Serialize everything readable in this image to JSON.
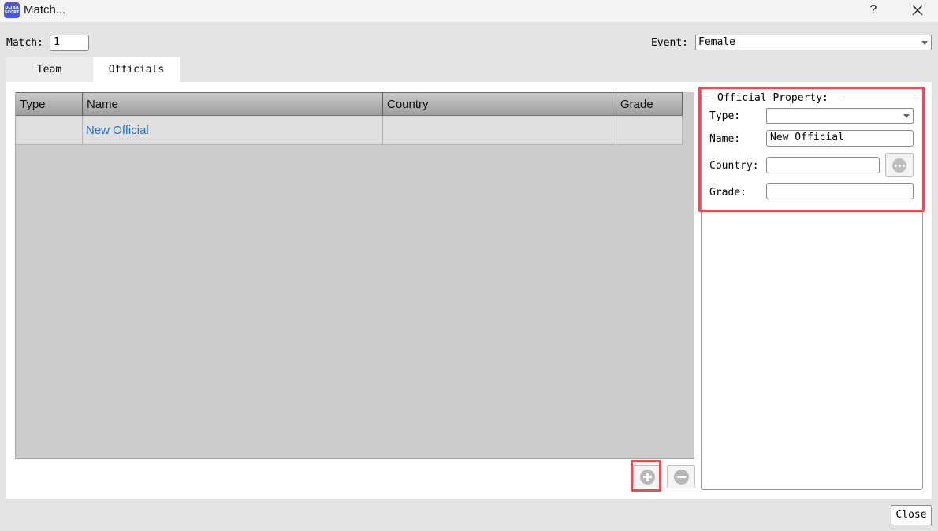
{
  "window": {
    "title": "Match...",
    "app_icon_text_1": "ULTRA",
    "app_icon_text_2": "SCORE",
    "help_label": "?"
  },
  "top": {
    "match_label": "Match:",
    "match_value": "1",
    "event_label": "Event:",
    "event_value": "Female"
  },
  "tabs": [
    {
      "label": "Team",
      "active": false
    },
    {
      "label": "Officials",
      "active": true
    }
  ],
  "table": {
    "columns": [
      "Type",
      "Name",
      "Country",
      "Grade"
    ],
    "rows": [
      {
        "type": "",
        "name": "New Official",
        "country": "",
        "grade": ""
      }
    ]
  },
  "property": {
    "title": "Official Property:",
    "type_label": "Type:",
    "type_value": "",
    "name_label": "Name:",
    "name_value": "New Official",
    "country_label": "Country:",
    "country_value": "",
    "grade_label": "Grade:",
    "grade_value": ""
  },
  "buttons": {
    "close_label": "Close"
  },
  "colors": {
    "highlight": "#ee4a55",
    "link_text": "#1a73c8",
    "app_icon": "#4a55e8"
  }
}
